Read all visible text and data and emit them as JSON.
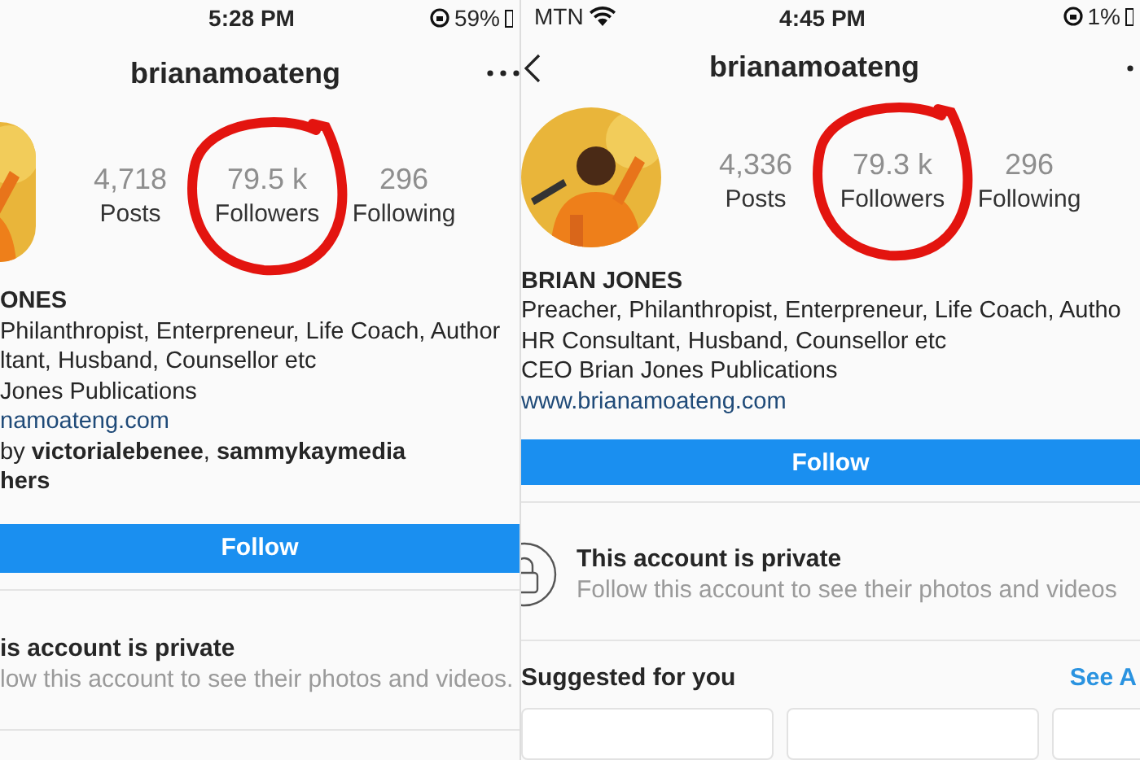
{
  "panels": [
    {
      "kind": "cropped",
      "status_bar": {
        "time": "5:28 PM",
        "battery": "59%"
      },
      "header": {
        "username": "brianamoateng"
      },
      "stats": [
        {
          "value": "4,718",
          "label": "Posts",
          "circled": false
        },
        {
          "value": "79.5 k",
          "label": "Followers",
          "circled": true
        },
        {
          "value": "296",
          "label": "Following",
          "circled": false
        }
      ],
      "bio": {
        "name": "ONES",
        "lines": [
          "Philanthropist, Enterpreneur, Life Coach, Author",
          "ltant, Husband, Counsellor etc",
          "Jones Publications"
        ],
        "link": "namoateng.com",
        "followed_by": "by **victorialebenee**, **sammykaymedia**",
        "followed_by_more": "hers"
      },
      "follow_button": "Follow",
      "private": {
        "title": "is account is private",
        "subtitle": "low this account to see their photos and videos."
      }
    },
    {
      "kind": "full",
      "status_bar": {
        "time": "4:45 PM",
        "battery": "1%",
        "carrier": "MTN"
      },
      "header": {
        "username": "brianamoateng",
        "back": true
      },
      "stats": [
        {
          "value": "4,336",
          "label": "Posts",
          "circled": false
        },
        {
          "value": "79.3 k",
          "label": "Followers",
          "circled": true
        },
        {
          "value": "296",
          "label": "Following",
          "circled": false
        }
      ],
      "bio": {
        "name": "BRIAN JONES",
        "lines": [
          "Preacher, Philanthropist, Enterpreneur, Life Coach, Autho",
          "HR Consultant, Husband, Counsellor etc",
          "CEO Brian Jones Publications"
        ],
        "link": "www.brianamoateng.com"
      },
      "follow_button": "Follow",
      "private": {
        "title": "This account is private",
        "subtitle": "Follow this account to see their photos and videos",
        "lock": true
      },
      "suggested": {
        "title": "Suggested for you",
        "see_all": "See A"
      }
    }
  ]
}
